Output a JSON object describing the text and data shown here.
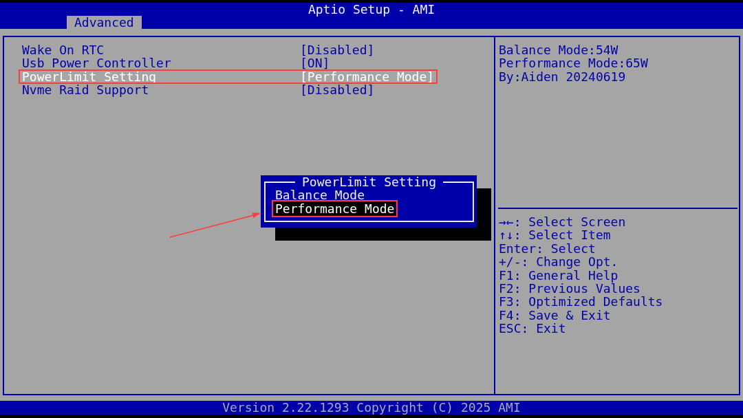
{
  "window": {
    "title": "Aptio Setup - AMI"
  },
  "tabs": [
    {
      "label": "Advanced",
      "selected": true
    }
  ],
  "settings": [
    {
      "label": "Wake On RTC",
      "value": "[Disabled]",
      "selected": false,
      "highlighted": false
    },
    {
      "label": "Usb Power Controller",
      "value": "[ON]",
      "selected": false,
      "highlighted": false
    },
    {
      "label": "PowerLimit Setting",
      "value": "[Performance Mode]",
      "selected": true,
      "highlighted": true
    },
    {
      "label": "Nvme Raid Support",
      "value": "[Disabled]",
      "selected": false,
      "highlighted": false
    }
  ],
  "help": {
    "description": [
      "Balance Mode:54W",
      "Performance Mode:65W",
      "By:Aiden 20240619"
    ],
    "keys": [
      "→←: Select Screen",
      "↑↓: Select Item",
      "Enter: Select",
      "+/-: Change Opt.",
      "F1: General Help",
      "F2: Previous Values",
      "F3: Optimized Defaults",
      "F4: Save & Exit",
      "ESC: Exit"
    ]
  },
  "popup": {
    "title": "PowerLimit Setting",
    "options": [
      {
        "label": "Balance Mode",
        "selected": false,
        "highlighted": false
      },
      {
        "label": "Performance Mode",
        "selected": true,
        "highlighted": true
      }
    ]
  },
  "status_bar": {
    "text": "Version 2.22.1293 Copyright (C) 2025 AMI"
  }
}
